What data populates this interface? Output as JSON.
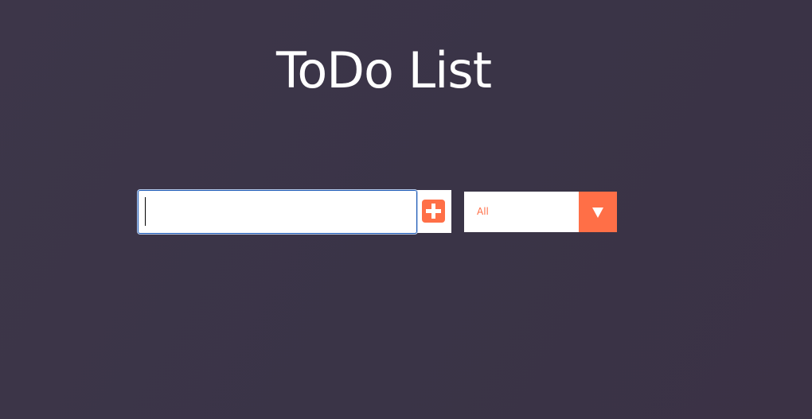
{
  "header": {
    "title": "ToDo List"
  },
  "todo_form": {
    "input_value": "",
    "input_placeholder": "",
    "add_button_icon": "plus-square-icon"
  },
  "filter": {
    "selected": "All",
    "arrow_icon": "triangle-down-icon"
  },
  "colors": {
    "background": "#3b3547",
    "accent": "#ff6f47",
    "title": "#ffffff",
    "input_focus_border": "#1e5ab4"
  }
}
